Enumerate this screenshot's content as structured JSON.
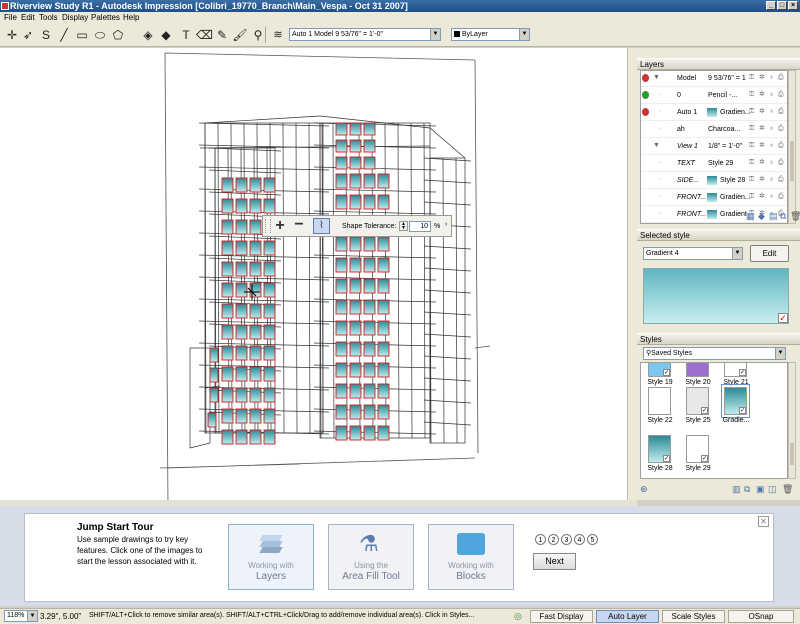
{
  "window": {
    "title": "Riverview Study R1 - Autodesk Impression [Colibri_19770_Branch\\Main_Vespa - Oct 31 2007]",
    "minimize_glyph": "_",
    "maximize_glyph": "□",
    "close_glyph": "×"
  },
  "menu": [
    "File",
    "Edit",
    "Tools",
    "Display",
    "Palettes",
    "Help"
  ],
  "toolbar": {
    "tools": [
      {
        "name": "select-icon",
        "glyph": "✛"
      },
      {
        "name": "lasso-select-icon",
        "glyph": "➶"
      },
      {
        "name": "curve-icon",
        "glyph": "S"
      },
      {
        "name": "line-icon",
        "glyph": "╱"
      },
      {
        "name": "rectangle-icon",
        "glyph": "▭"
      },
      {
        "name": "ellipse-icon",
        "glyph": "⬭"
      },
      {
        "name": "polygon-icon",
        "glyph": "⬠"
      },
      {
        "name": "area-fill-icon",
        "glyph": "◈"
      },
      {
        "name": "shape-fill-icon",
        "glyph": "◆"
      },
      {
        "name": "text-icon",
        "glyph": "T"
      },
      {
        "name": "eraser-icon",
        "glyph": "⌫"
      },
      {
        "name": "pencil-icon",
        "glyph": "✎"
      },
      {
        "name": "brush-icon",
        "glyph": "🖌"
      },
      {
        "name": "stamp-icon",
        "glyph": "⚲"
      }
    ],
    "layer_combo": "Auto 1   Model   9 53/76\" = 1'-0\"",
    "color_combo": "ByLayer"
  },
  "float_toolbar": {
    "shape_tolerance_label": "Shape Tolerance:",
    "tolerance_value": "10",
    "unit": "%"
  },
  "layers_panel": {
    "title": "Layers",
    "rows": [
      {
        "name": "Model",
        "value": "9 53/76\" = 1'-0\"",
        "indent": 0,
        "swatch": false,
        "italic": false,
        "marker": "#c33"
      },
      {
        "name": "0",
        "value": "Pencil -...",
        "indent": 1,
        "swatch": false,
        "italic": false,
        "marker": "#2a9a2a"
      },
      {
        "name": "Auto 1",
        "value": "Gradien...",
        "indent": 1,
        "swatch": true,
        "italic": false,
        "marker": "#c33"
      },
      {
        "name": "ah",
        "value": "Charcoa...",
        "indent": 1,
        "swatch": false,
        "italic": false,
        "marker": ""
      },
      {
        "name": "View 1",
        "value": "1/8\" = 1'-0\"",
        "indent": 0,
        "swatch": false,
        "italic": true,
        "marker": ""
      },
      {
        "name": "TEXT",
        "value": "Style 29",
        "indent": 1,
        "swatch": false,
        "italic": true,
        "marker": ""
      },
      {
        "name": "SIDE...",
        "value": "Style 28",
        "indent": 1,
        "swatch": true,
        "italic": true,
        "marker": ""
      },
      {
        "name": "FRONT...",
        "value": "Gradien...",
        "indent": 1,
        "swatch": true,
        "italic": true,
        "marker": ""
      },
      {
        "name": "FRONT...",
        "value": "Gradient",
        "indent": 1,
        "swatch": true,
        "italic": true,
        "marker": ""
      }
    ]
  },
  "selected_style_panel": {
    "title": "Selected style",
    "style": "Gradient 4",
    "edit_label": "Edit"
  },
  "styles_panel": {
    "title": "Styles",
    "filter": "Saved Styles",
    "tiles": [
      {
        "label": "Style 19",
        "fill": "#7cc7ef",
        "checked": true
      },
      {
        "label": "Style 20",
        "fill": "#9b6fd0",
        "checked": false
      },
      {
        "label": "Style 21",
        "fill": "#ffffff",
        "checked": true
      },
      {
        "label": "Style 22",
        "fill": "#ffffff",
        "checked": false
      },
      {
        "label": "Style 25",
        "fill": "#e8e8e8",
        "checked": true
      },
      {
        "label": "Gradie...",
        "fill": "gradient",
        "checked": true
      },
      {
        "label": "Style 28",
        "fill": "gradient",
        "checked": true
      },
      {
        "label": "Style 29",
        "fill": "#ffffff",
        "checked": true
      }
    ]
  },
  "tour": {
    "title": "Jump Start Tour",
    "description": "Use sample drawings to try key features. Click one of the images to start the lesson associated with it.",
    "lessons": [
      {
        "small": "Working with",
        "big": "Layers"
      },
      {
        "small": "Using the",
        "big": "Area Fill Tool"
      },
      {
        "small": "Working with",
        "big": "Blocks"
      }
    ],
    "steps": [
      "1",
      "2",
      "3",
      "4",
      "5"
    ],
    "next_label": "Next",
    "close_glyph": "✕"
  },
  "status": {
    "zoom": "118%",
    "coords": "3.29\", 5.00\"",
    "hint": "SHIFT/ALT+Click to remove similar area(s). SHIFT/ALT+CTRL+Click/Drag to add/remove individual area(s). Click in Styles...",
    "buttons": [
      "Fast Display",
      "Auto Layer",
      "Scale Styles",
      "OSnap"
    ]
  },
  "colors": {
    "accent_blue": "#3a6ea5",
    "fill_gradient_top": "#2d8a96",
    "fill_gradient_bottom": "#c0ecef",
    "selection_red": "#d21c1c"
  }
}
